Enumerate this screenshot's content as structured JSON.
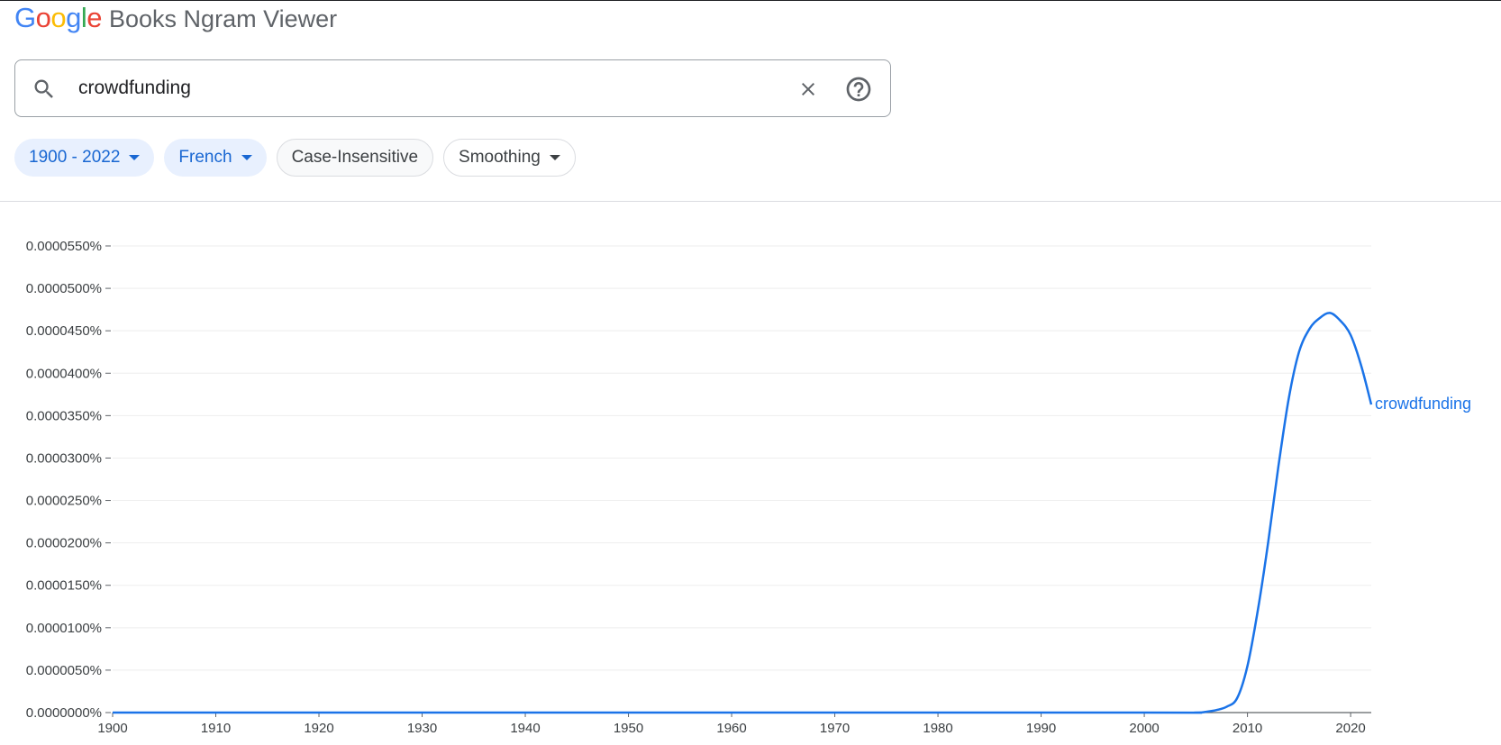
{
  "header": {
    "logo_letters": [
      {
        "ch": "G",
        "color": "#4285F4"
      },
      {
        "ch": "o",
        "color": "#EA4335"
      },
      {
        "ch": "o",
        "color": "#FBBC05"
      },
      {
        "ch": "g",
        "color": "#4285F4"
      },
      {
        "ch": "l",
        "color": "#34A853"
      },
      {
        "ch": "e",
        "color": "#EA4335"
      }
    ],
    "title": "Books Ngram Viewer"
  },
  "search": {
    "value": "crowdfunding"
  },
  "chips": {
    "year_range": "1900 - 2022",
    "language": "French",
    "case": "Case-Insensitive",
    "smoothing": "Smoothing"
  },
  "chart_data": {
    "type": "line",
    "xlim": [
      1900,
      2022
    ],
    "ylim": [
      0,
      5.5e-05
    ],
    "y_ticks": [
      {
        "value": 0,
        "label": "0.0000000%"
      },
      {
        "value": 5e-06,
        "label": "0.0000050%"
      },
      {
        "value": 1e-05,
        "label": "0.0000100%"
      },
      {
        "value": 1.5e-05,
        "label": "0.0000150%"
      },
      {
        "value": 2e-05,
        "label": "0.0000200%"
      },
      {
        "value": 2.5e-05,
        "label": "0.0000250%"
      },
      {
        "value": 3e-05,
        "label": "0.0000300%"
      },
      {
        "value": 3.5e-05,
        "label": "0.0000350%"
      },
      {
        "value": 4e-05,
        "label": "0.0000400%"
      },
      {
        "value": 4.5e-05,
        "label": "0.0000450%"
      },
      {
        "value": 5e-05,
        "label": "0.0000500%"
      },
      {
        "value": 5.5e-05,
        "label": "0.0000550%"
      }
    ],
    "x_ticks": [
      {
        "value": 1900,
        "label": "1900"
      },
      {
        "value": 1910,
        "label": "1910"
      },
      {
        "value": 1920,
        "label": "1920"
      },
      {
        "value": 1930,
        "label": "1930"
      },
      {
        "value": 1940,
        "label": "1940"
      },
      {
        "value": 1950,
        "label": "1950"
      },
      {
        "value": 1960,
        "label": "1960"
      },
      {
        "value": 1970,
        "label": "1970"
      },
      {
        "value": 1980,
        "label": "1980"
      },
      {
        "value": 1990,
        "label": "1990"
      },
      {
        "value": 2000,
        "label": "2000"
      },
      {
        "value": 2010,
        "label": "2010"
      },
      {
        "value": 2020,
        "label": "2020"
      }
    ],
    "grid": true,
    "series": [
      {
        "name": "crowdfunding",
        "color": "#1a73e8",
        "x": [
          1900,
          1950,
          2000,
          2005,
          2006,
          2007,
          2008,
          2009,
          2010,
          2011,
          2012,
          2013,
          2014,
          2015,
          2016,
          2017,
          2018,
          2019,
          2020,
          2021,
          2022
        ],
        "y": [
          0,
          0,
          0,
          0,
          1e-07,
          3e-07,
          7e-07,
          1.7e-06,
          5.5e-06,
          1.2e-05,
          2e-05,
          2.9e-05,
          3.7e-05,
          4.25e-05,
          4.52e-05,
          4.65e-05,
          4.71e-05,
          4.62e-05,
          4.45e-05,
          4.1e-05,
          3.63e-05
        ]
      }
    ]
  }
}
